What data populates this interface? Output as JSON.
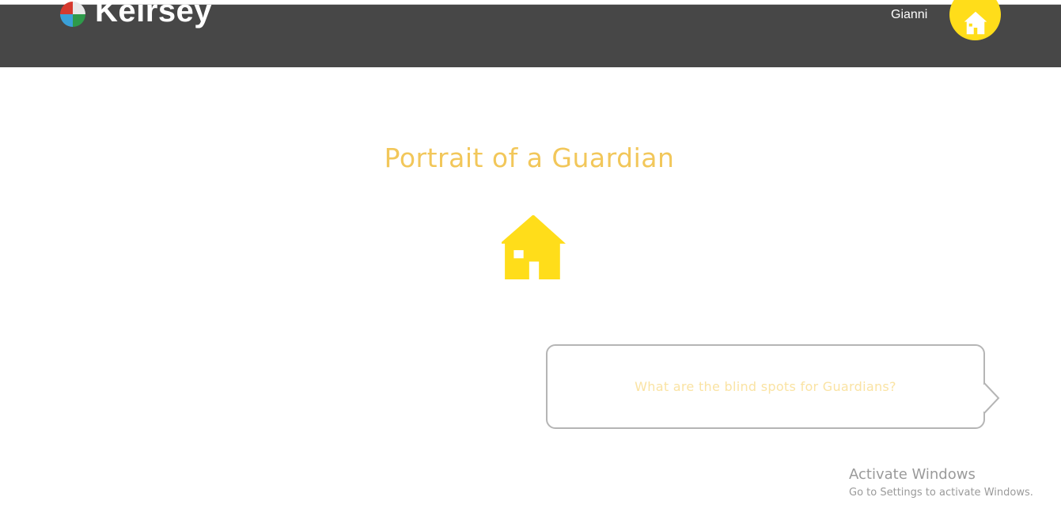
{
  "header": {
    "brand": "Keirsey",
    "username": "Gianni",
    "avatar_icon": "home-icon",
    "background": "#474747"
  },
  "main": {
    "title": "Portrait of a Guardian",
    "icon": "home-icon",
    "icon_color": "#ffdd1a",
    "question": "What are the blind spots for Guardians?"
  },
  "watermark": {
    "title": "Activate Windows",
    "subtitle": "Go to Settings to activate Windows."
  }
}
